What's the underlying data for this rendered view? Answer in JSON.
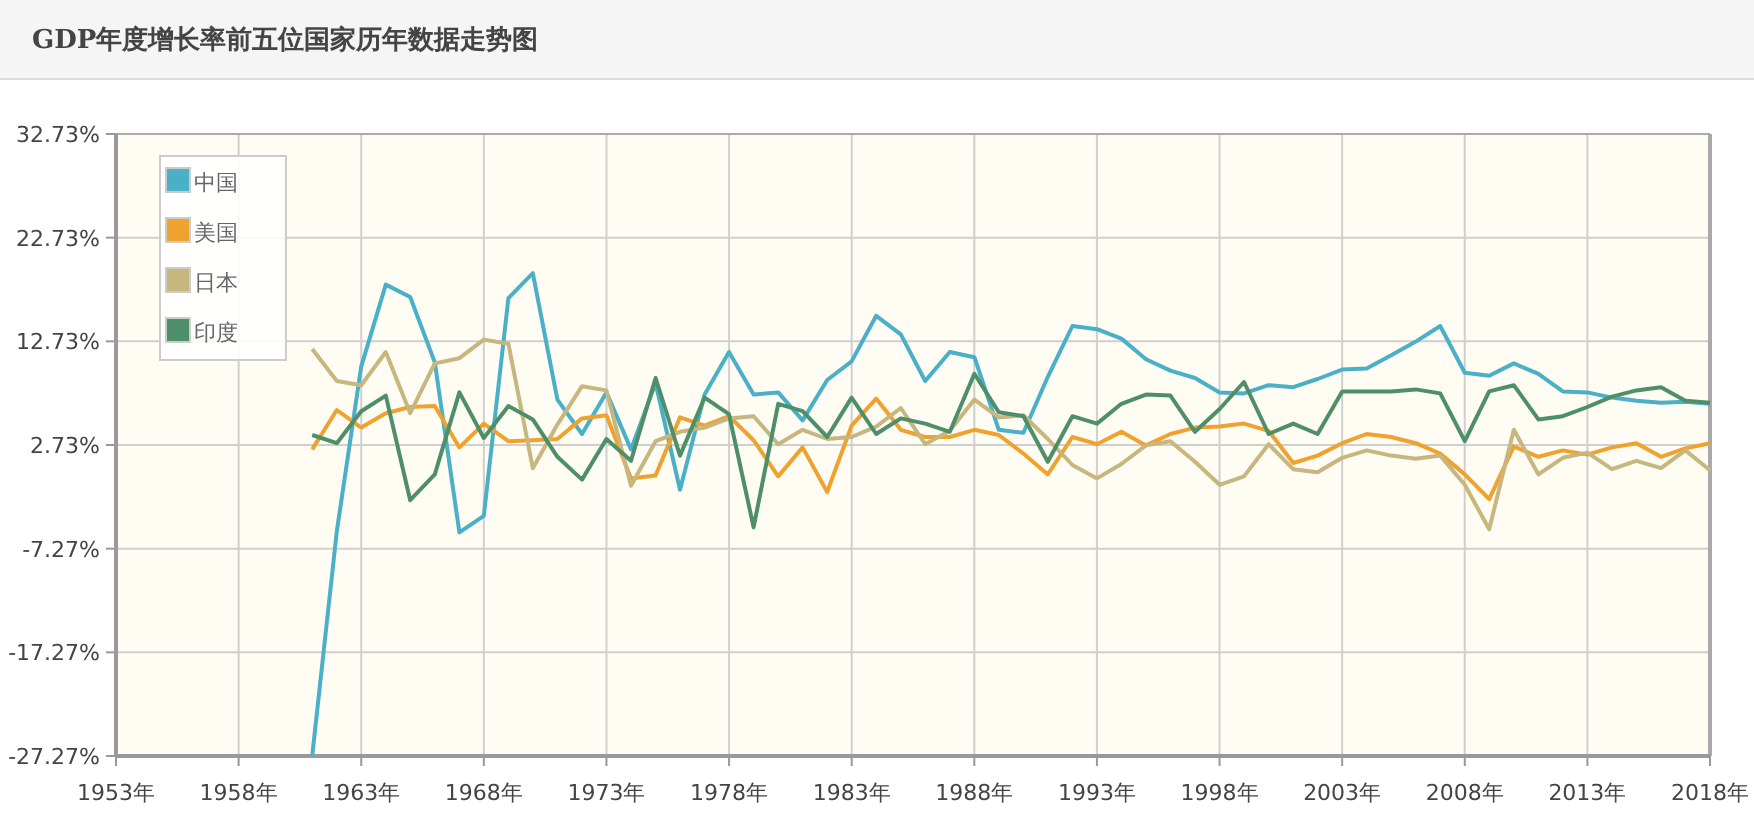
{
  "header": {
    "title": "GDP年度增长率前五位国家历年数据走势图"
  },
  "chart": {
    "chart_data": {
      "type": "line",
      "x": [
        1961,
        1962,
        1963,
        1964,
        1965,
        1966,
        1967,
        1968,
        1969,
        1970,
        1971,
        1972,
        1973,
        1974,
        1975,
        1976,
        1977,
        1978,
        1979,
        1980,
        1981,
        1982,
        1983,
        1984,
        1985,
        1986,
        1987,
        1988,
        1989,
        1990,
        1991,
        1992,
        1993,
        1994,
        1995,
        1996,
        1997,
        1998,
        1999,
        2000,
        2001,
        2002,
        2003,
        2004,
        2005,
        2006,
        2007,
        2008,
        2009,
        2010,
        2011,
        2012,
        2013,
        2014,
        2015,
        2016,
        2017,
        2018
      ],
      "grid": true,
      "legend": true,
      "xlim": [
        1953,
        2018
      ],
      "ylim": [
        -27.27,
        32.73
      ],
      "xticks": [
        {
          "value": 1953,
          "label": "1953年"
        },
        {
          "value": 1958,
          "label": "1958年"
        },
        {
          "value": 1963,
          "label": "1963年"
        },
        {
          "value": 1968,
          "label": "1968年"
        },
        {
          "value": 1973,
          "label": "1973年"
        },
        {
          "value": 1978,
          "label": "1978年"
        },
        {
          "value": 1983,
          "label": "1983年"
        },
        {
          "value": 1988,
          "label": "1988年"
        },
        {
          "value": 1993,
          "label": "1993年"
        },
        {
          "value": 1998,
          "label": "1998年"
        },
        {
          "value": 2003,
          "label": "2003年"
        },
        {
          "value": 2008,
          "label": "2008年"
        },
        {
          "value": 2013,
          "label": "2013年"
        },
        {
          "value": 2018,
          "label": "2018年"
        }
      ],
      "yticks": [
        {
          "value": 32.73,
          "label": "32.73%"
        },
        {
          "value": 22.73,
          "label": "22.73%"
        },
        {
          "value": 12.73,
          "label": "12.73%"
        },
        {
          "value": 2.73,
          "label": "2.73%"
        },
        {
          "value": -7.27,
          "label": "-7.27%"
        },
        {
          "value": -17.27,
          "label": "-17.27%"
        },
        {
          "value": -27.27,
          "label": "-27.27%"
        }
      ],
      "series": [
        {
          "name": "中国",
          "color": "#4ab0c8",
          "values": [
            -27.27,
            -5.6,
            10.3,
            18.2,
            17.0,
            10.7,
            -5.7,
            -4.1,
            16.9,
            19.3,
            7.1,
            3.8,
            7.8,
            2.3,
            8.7,
            -1.6,
            7.6,
            11.7,
            7.6,
            7.8,
            5.1,
            9.0,
            10.8,
            15.2,
            13.4,
            8.9,
            11.7,
            11.2,
            4.2,
            3.9,
            9.3,
            14.2,
            13.9,
            13.0,
            11.0,
            9.9,
            9.2,
            7.8,
            7.7,
            8.5,
            8.3,
            9.1,
            10.0,
            10.1,
            11.4,
            12.7,
            14.2,
            9.7,
            9.4,
            10.6,
            9.6,
            7.9,
            7.8,
            7.3,
            7.0,
            6.8,
            6.9,
            6.7
          ]
        },
        {
          "name": "美国",
          "color": "#f0a22e",
          "values": [
            2.3,
            6.1,
            4.4,
            5.8,
            6.4,
            6.5,
            2.5,
            4.8,
            3.1,
            3.2,
            3.3,
            5.3,
            5.6,
            -0.5,
            -0.2,
            5.4,
            4.6,
            5.5,
            3.2,
            -0.3,
            2.5,
            -1.8,
            4.6,
            7.2,
            4.2,
            3.5,
            3.5,
            4.2,
            3.7,
            1.9,
            -0.1,
            3.5,
            2.8,
            4.0,
            2.7,
            3.8,
            4.4,
            4.5,
            4.8,
            4.1,
            1.0,
            1.7,
            2.9,
            3.8,
            3.5,
            2.9,
            1.9,
            -0.1,
            -2.5,
            2.6,
            1.6,
            2.2,
            1.8,
            2.5,
            2.9,
            1.6,
            2.4,
            2.9
          ]
        },
        {
          "name": "日本",
          "color": "#c8b67f",
          "values": [
            12.0,
            8.9,
            8.5,
            11.7,
            5.8,
            10.6,
            11.1,
            12.9,
            12.5,
            0.5,
            4.7,
            8.4,
            8.0,
            -1.2,
            3.1,
            4.0,
            4.4,
            5.3,
            5.5,
            2.8,
            4.2,
            3.3,
            3.5,
            4.5,
            6.3,
            2.8,
            4.1,
            7.1,
            5.4,
            5.6,
            3.3,
            0.8,
            -0.5,
            0.9,
            2.7,
            3.1,
            1.1,
            -1.1,
            -0.3,
            2.8,
            0.4,
            0.1,
            1.5,
            2.2,
            1.7,
            1.4,
            1.7,
            -1.1,
            -5.4,
            4.2,
            -0.1,
            1.5,
            2.0,
            0.4,
            1.2,
            0.5,
            2.2,
            0.3
          ]
        },
        {
          "name": "印度",
          "color": "#4e8f6a",
          "values": [
            3.7,
            2.9,
            6.0,
            7.5,
            -2.6,
            -0.1,
            7.8,
            3.4,
            6.5,
            5.2,
            1.6,
            -0.6,
            3.3,
            1.2,
            9.2,
            1.7,
            7.3,
            5.7,
            -5.2,
            6.7,
            6.0,
            3.5,
            7.3,
            3.8,
            5.3,
            4.8,
            4.0,
            9.6,
            5.9,
            5.5,
            1.1,
            5.5,
            4.8,
            6.7,
            7.6,
            7.5,
            4.0,
            6.2,
            8.8,
            3.8,
            4.8,
            3.8,
            7.9,
            7.9,
            7.9,
            8.1,
            7.7,
            3.1,
            7.9,
            8.5,
            5.2,
            5.5,
            6.4,
            7.4,
            8.0,
            8.3,
            7.0,
            6.8
          ]
        }
      ]
    }
  }
}
